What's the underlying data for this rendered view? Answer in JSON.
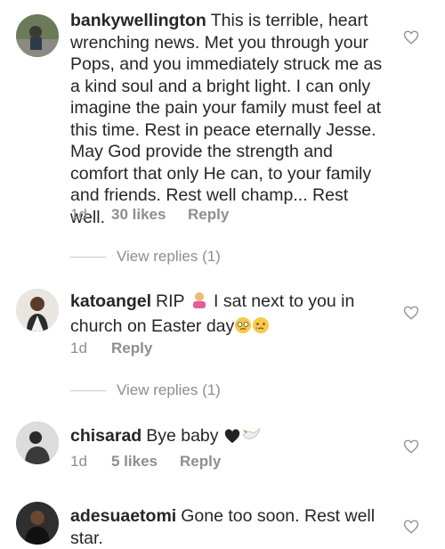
{
  "comments": [
    {
      "username": "bankywellington",
      "text": "This is terrible, heart wrenching news. Met you through your Pops, and you immediately struck me as a kind soul and a bright light. I can only imagine the pain your family must feel at this time. Rest in peace eternally Jesse. May God provide the strength and comfort that only He can, to your family and friends. Rest well champ... Rest well.",
      "time": "1d",
      "likes": "30 likes",
      "reply": "Reply",
      "view_replies": "View replies (1)"
    },
    {
      "username": "katoangel",
      "text_a": "RIP",
      "text_b": "I sat next to you in church on Easter day",
      "time": "1d",
      "reply": "Reply",
      "view_replies": "View replies (1)"
    },
    {
      "username": "chisarad",
      "text": "Bye baby",
      "time": "1d",
      "likes": "5 likes",
      "reply": "Reply"
    },
    {
      "username": "adesuaetomi",
      "text": "Gone too soon. Rest well star."
    }
  ],
  "icons": {
    "like": "heart-outline-icon",
    "emoji_1": "person-bowing-emoji",
    "emoji_2": "pleading-face-emoji",
    "emoji_3": "crying-face-emoji",
    "emoji_4": "black-heart-emoji",
    "emoji_5": "dove-emoji"
  }
}
